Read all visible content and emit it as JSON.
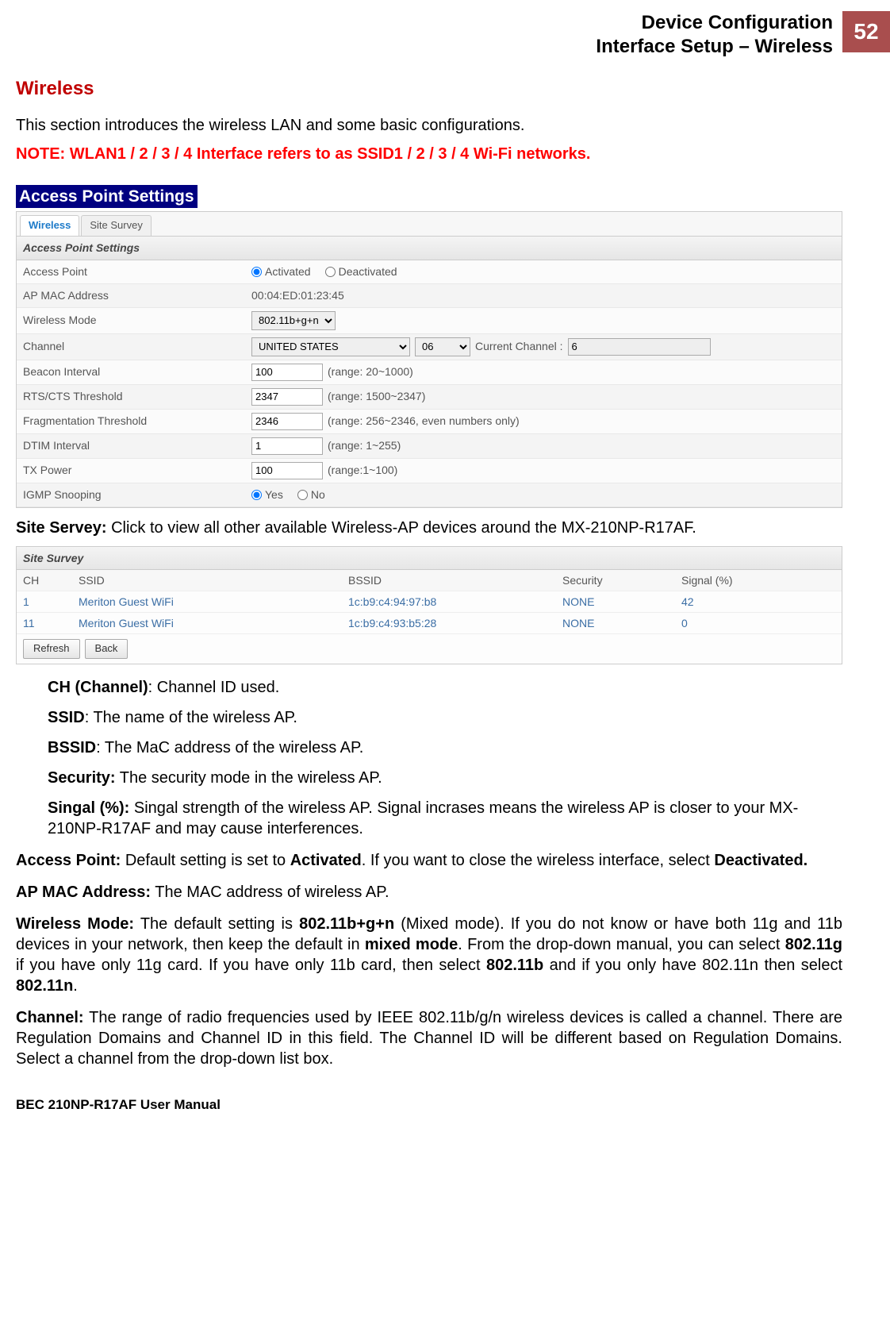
{
  "header": {
    "line1": "Device Configuration",
    "line2": "Interface Setup – Wireless",
    "page": "52"
  },
  "title": "Wireless",
  "intro": "This section introduces the wireless LAN and some basic configurations.",
  "note": "NOTE: WLAN1 / 2 / 3 / 4 Interface refers to as SSID1 / 2 / 3 / 4 Wi-Fi networks.",
  "aps_heading": "Access Point Settings",
  "tabs": {
    "wireless": "Wireless",
    "site_survey": "Site Survey"
  },
  "aps_section_label": "Access Point Settings",
  "rows": {
    "ap": {
      "label": "Access Point",
      "opt1": "Activated",
      "opt2": "Deactivated"
    },
    "mac": {
      "label": "AP MAC Address",
      "value": "00:04:ED:01:23:45"
    },
    "mode": {
      "label": "Wireless Mode",
      "value": "802.11b+g+n"
    },
    "channel": {
      "label": "Channel",
      "country": "UNITED STATES",
      "ch": "06",
      "cur_label": "Current Channel :",
      "cur_value": "6"
    },
    "beacon": {
      "label": "Beacon Interval",
      "value": "100",
      "hint": "(range: 20~1000)"
    },
    "rts": {
      "label": "RTS/CTS Threshold",
      "value": "2347",
      "hint": "(range: 1500~2347)"
    },
    "frag": {
      "label": "Fragmentation Threshold",
      "value": "2346",
      "hint": "(range: 256~2346, even numbers only)"
    },
    "dtim": {
      "label": "DTIM Interval",
      "value": "1",
      "hint": "(range: 1~255)"
    },
    "txp": {
      "label": "TX Power",
      "value": "100",
      "hint": "(range:1~100)"
    },
    "igmp": {
      "label": "IGMP Snooping",
      "opt1": "Yes",
      "opt2": "No"
    }
  },
  "site_survey_intro_b": "Site Servey:",
  "site_survey_intro": " Click to view all other available Wireless-AP devices around the MX-210NP-R17AF.",
  "survey": {
    "header": "Site Survey",
    "cols": {
      "ch": "CH",
      "ssid": "SSID",
      "bssid": "BSSID",
      "sec": "Security",
      "sig": "Signal (%)"
    },
    "rows": [
      {
        "ch": "1",
        "ssid": "Meriton Guest WiFi",
        "bssid": "1c:b9:c4:94:97:b8",
        "sec": "NONE",
        "sig": "42"
      },
      {
        "ch": "11",
        "ssid": "Meriton Guest WiFi",
        "bssid": "1c:b9:c4:93:b5:28",
        "sec": "NONE",
        "sig": "0"
      }
    ],
    "btn_refresh": "Refresh",
    "btn_back": "Back"
  },
  "defs": {
    "ch_b": "CH (Channel)",
    "ch_t": ": Channel ID used.",
    "ssid_b": "SSID",
    "ssid_t": ": The name of the wireless AP.",
    "bssid_b": "BSSID",
    "bssid_t": ": The MaC address of the wireless AP.",
    "sec_b": "Security:",
    "sec_t": " The security mode in the wireless AP.",
    "sig_b": "Singal (%):",
    "sig_t": " Singal strength of the wireless AP. Signal incrases means the wireless AP is closer to your MX-210NP-R17AF and may cause interferences."
  },
  "paras": {
    "ap_b": "Access Point:",
    "ap_t1": " Default setting is set to ",
    "ap_t2": "Activated",
    "ap_t3": ". If you want to close the wireless interface, select ",
    "ap_t4": "Deactivated.",
    "mac_b": "AP MAC Address:",
    "mac_t": " The MAC address of wireless AP.",
    "mode_b": "Wireless Mode:",
    "mode_t1": " The default setting is ",
    "mode_t2": "802.11b+g+n",
    "mode_t3": " (Mixed mode). If you do not know or have both 11g and 11b devices in your network, then keep the default in ",
    "mode_t4": "mixed mode",
    "mode_t5": ". From the drop-down manual, you can select ",
    "mode_t6": "802.11g",
    "mode_t7": " if you have only 11g card. If you have only 11b card, then select ",
    "mode_t8": "802.11b",
    "mode_t9": " and if you only have 802.11n then select ",
    "mode_t10": "802.11n",
    "mode_t11": ".",
    "ch_b": "Channel:",
    "ch_t": " The range of radio frequencies used by IEEE 802.11b/g/n wireless devices is called a channel. There are Regulation Domains and Channel ID in this field. The Channel ID will be different based on Regulation Domains. Select a channel from the drop-down list box."
  },
  "footer": "BEC 210NP-R17AF User Manual"
}
